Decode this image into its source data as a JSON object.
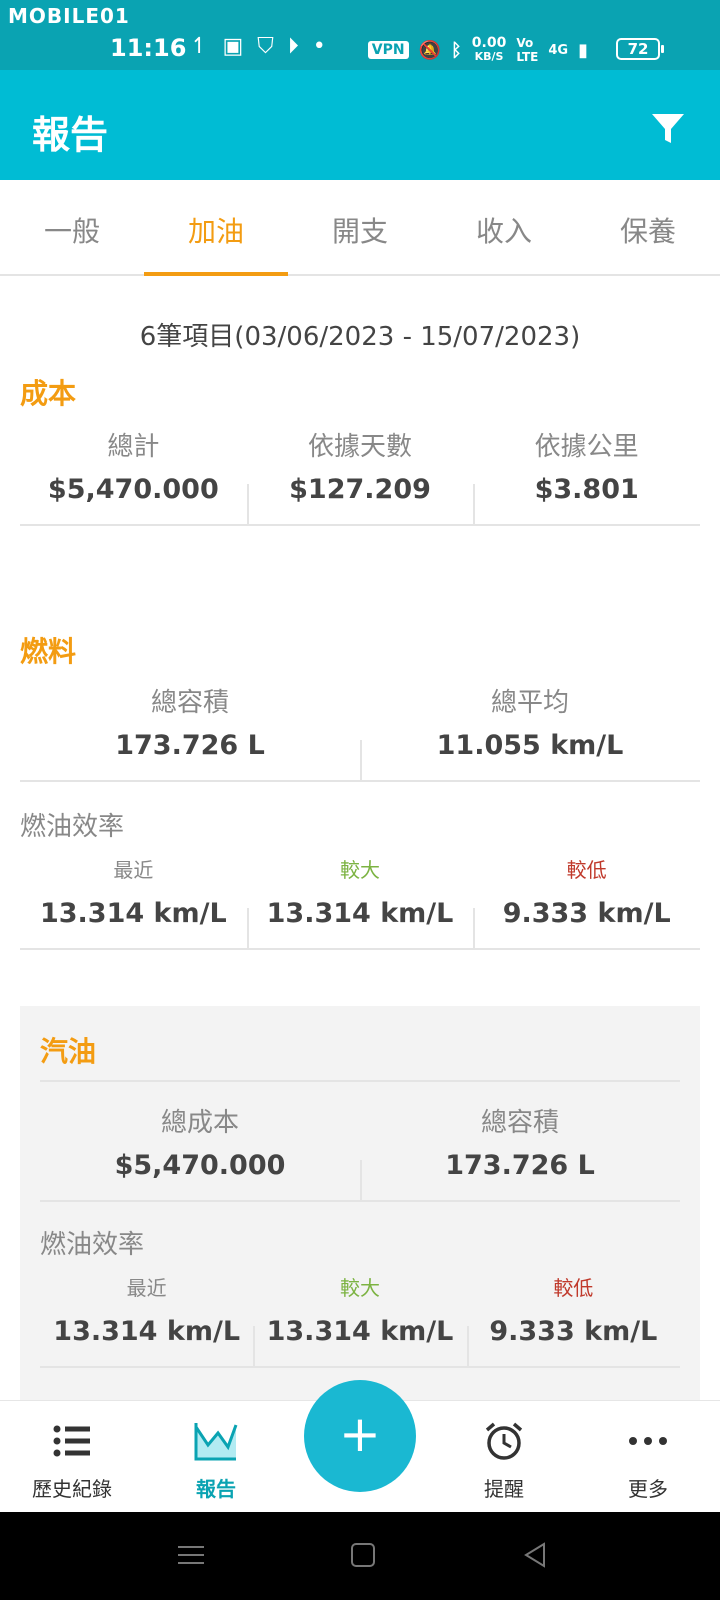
{
  "status_bar": {
    "watermark": "MOBILE01",
    "time": "11:16",
    "vpn": "VPN",
    "speed_value": "0.00",
    "speed_unit": "KB/S",
    "network": "4G",
    "battery": "72"
  },
  "app_bar": {
    "title": "報告",
    "filter_icon": "filter-icon"
  },
  "tabs": [
    {
      "label": "一般",
      "active": false
    },
    {
      "label": "加油",
      "active": true
    },
    {
      "label": "開支",
      "active": false
    },
    {
      "label": "收入",
      "active": false
    },
    {
      "label": "保養",
      "active": false
    }
  ],
  "summary": "6筆項目(03/06/2023 - 15/07/2023)",
  "cost": {
    "title": "成本",
    "total_label": "總計",
    "total_value": "$5,470.000",
    "per_day_label": "依據天數",
    "per_day_value": "$127.209",
    "per_km_label": "依據公里",
    "per_km_value": "$3.801"
  },
  "fuel": {
    "title": "燃料",
    "volume_label": "總容積",
    "volume_value": "173.726 L",
    "average_label": "總平均",
    "average_value": "11.055 km/L",
    "efficiency_title": "燃油效率",
    "recent_label": "最近",
    "recent_value": "13.314 km/L",
    "max_label": "較大",
    "max_value": "13.314 km/L",
    "min_label": "較低",
    "min_value": "9.333 km/L"
  },
  "gasoline": {
    "title": "汽油",
    "cost_label": "總成本",
    "cost_value": "$5,470.000",
    "volume_label": "總容積",
    "volume_value": "173.726 L",
    "efficiency_title": "燃油效率",
    "recent_label": "最近",
    "recent_value": "13.314 km/L",
    "max_label": "較大",
    "max_value": "13.314 km/L",
    "min_label": "較低",
    "min_value": "9.333 km/L"
  },
  "bottom_nav": {
    "history": "歷史紀錄",
    "reports": "報告",
    "add": "+",
    "reminders": "提醒",
    "more": "更多"
  },
  "colors": {
    "status_bar": "#0aa3b2",
    "app_bar": "#00bcd4",
    "accent": "#f39c12",
    "max": "#7cb342",
    "min": "#c0392b",
    "fab": "#1ab8d2"
  }
}
